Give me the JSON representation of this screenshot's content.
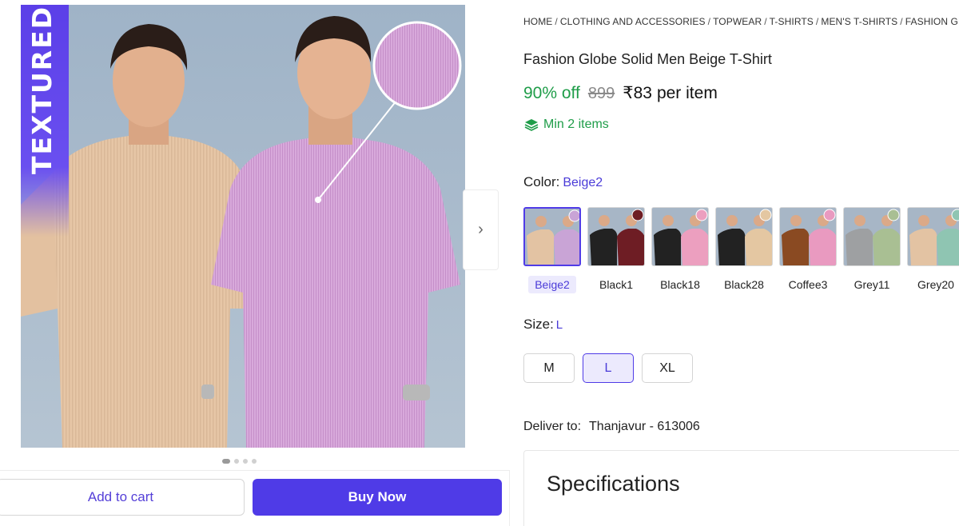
{
  "gallery": {
    "banner_text": "TEXTURED",
    "dots_count": 4,
    "active_dot": 0
  },
  "actions": {
    "add_to_cart": "Add to cart",
    "buy_now": "Buy Now"
  },
  "breadcrumb": [
    "HOME",
    "CLOTHING AND ACCESSORIES",
    "TOPWEAR",
    "T-SHIRTS",
    "MEN'S T-SHIRTS",
    "FASHION GLOBE"
  ],
  "product": {
    "title": "Fashion Globe Solid Men Beige T-Shirt",
    "discount": "90% off",
    "mrp": "899",
    "price": "₹83",
    "price_suffix": "per item",
    "min_items": "Min 2 items"
  },
  "color": {
    "label": "Color:",
    "selected": "Beige2",
    "options": [
      {
        "name": "Beige2",
        "left": "#e3c3a3",
        "right": "#c9a4d6"
      },
      {
        "name": "Black1",
        "left": "#222222",
        "right": "#6e1d24"
      },
      {
        "name": "Black18",
        "left": "#222222",
        "right": "#ec9fbf"
      },
      {
        "name": "Black28",
        "left": "#222222",
        "right": "#e4c7a2"
      },
      {
        "name": "Coffee3",
        "left": "#8a4a22",
        "right": "#e99ac0"
      },
      {
        "name": "Grey11",
        "left": "#9ea0a2",
        "right": "#a9bf93"
      },
      {
        "name": "Grey20",
        "left": "#e3c3a3",
        "right": "#8fc5b2"
      }
    ]
  },
  "size": {
    "label": "Size:",
    "selected": "L",
    "options": [
      "M",
      "L",
      "XL"
    ]
  },
  "delivery": {
    "label": "Deliver to:",
    "location": "Thanjavur - 613006"
  },
  "specs": {
    "title": "Specifications"
  },
  "colors": {
    "accent": "#4f3be7",
    "discount_green": "#1f9d49",
    "banner_purple": "#5b3fe8"
  }
}
